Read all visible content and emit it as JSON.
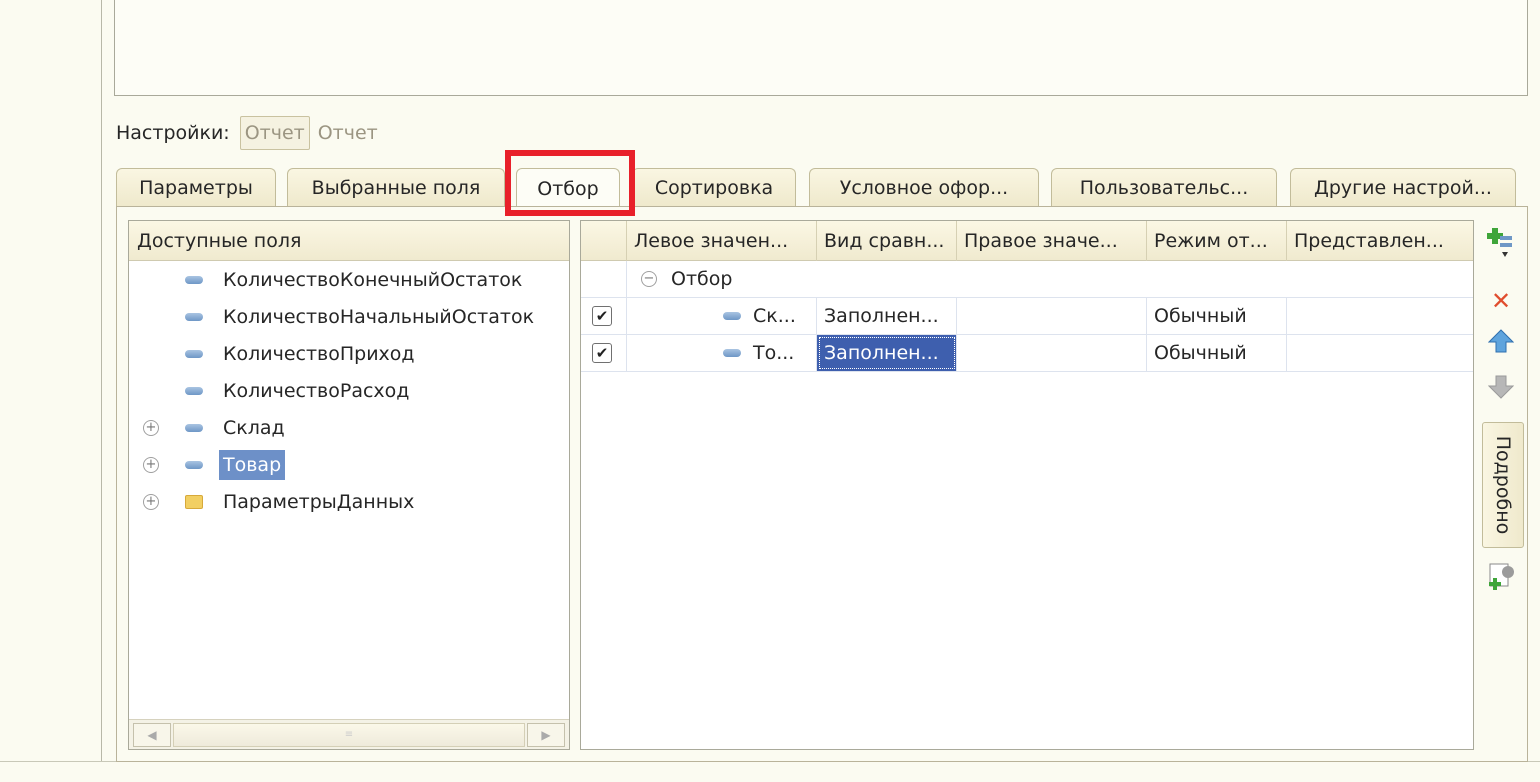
{
  "settings": {
    "label": "Настройки:",
    "variant_button": "Отчет",
    "variant_text": "Отчет"
  },
  "tabs": [
    {
      "label": "Параметры"
    },
    {
      "label": "Выбранные поля"
    },
    {
      "label": "Отбор",
      "active": true
    },
    {
      "label": "Сортировка"
    },
    {
      "label": "Условное офор..."
    },
    {
      "label": "Пользовательс..."
    },
    {
      "label": "Другие настрой..."
    }
  ],
  "fields_tree": {
    "header": "Доступные поля",
    "items": [
      {
        "label": "КоличествоКонечныйОстаток",
        "icon": "field-icon"
      },
      {
        "label": "КоличествоНачальныйОстаток",
        "icon": "field-icon"
      },
      {
        "label": "КоличествоПриход",
        "icon": "field-icon"
      },
      {
        "label": "КоличествоРасход",
        "icon": "field-icon"
      },
      {
        "label": "Склад",
        "icon": "field-icon",
        "expandable": true
      },
      {
        "label": "Товар",
        "icon": "field-icon",
        "expandable": true,
        "selected": true
      },
      {
        "label": "ПараметрыДанных",
        "icon": "folder-icon",
        "expandable": true
      }
    ]
  },
  "filter_grid": {
    "columns": [
      "Левое значен...",
      "Вид сравн...",
      "Правое значе...",
      "Режим от...",
      "Представлен..."
    ],
    "group_label": "Отбор",
    "rows": [
      {
        "checked": true,
        "left": "Ск...",
        "comparison": "Заполнен...",
        "right": "",
        "mode": "Обычный",
        "presentation": ""
      },
      {
        "checked": true,
        "left": "То...",
        "comparison": "Заполнен...",
        "right": "",
        "mode": "Обычный",
        "presentation": "",
        "selected_cell": "comparison"
      }
    ]
  },
  "toolbar": {
    "details_label": "Подробно",
    "icons": [
      "add-group-icon",
      "delete-icon",
      "move-up-icon",
      "move-down-icon",
      "add-settings-icon"
    ]
  },
  "colors": {
    "highlight": "#e8202a",
    "selection": "#3e5fae",
    "background": "#fbfbf1"
  }
}
